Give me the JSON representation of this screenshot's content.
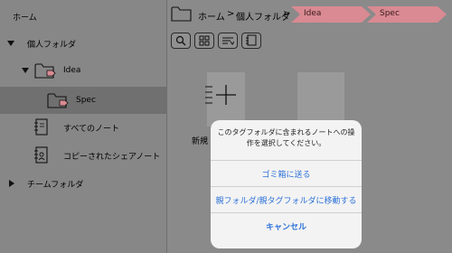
{
  "sidebar": {
    "home": "ホーム",
    "personal_folder": "個人フォルダ",
    "idea": "Idea",
    "spec": "Spec",
    "all_notes": "すべてのノート",
    "copied_shared_notes": "コピーされたシェアノート",
    "team_folder": "チームフォルダ"
  },
  "breadcrumb": {
    "home": "ホーム",
    "sep1": ">",
    "personal": "個人フォルダ",
    "sep2": ">",
    "tag1": "Idea",
    "tag2": "Spec"
  },
  "toolbar": {
    "icons": [
      "search-icon",
      "grid-icon",
      "sort-icon",
      "notebook-icon"
    ]
  },
  "main": {
    "new_note_label": "新規"
  },
  "dialog": {
    "message_line1": "このタグフォルダに含まれるノートへの操",
    "message_line2": "作を選択してください。",
    "trash_button": "ゴミ箱に送る",
    "move_button": "親フォルダ/親タグフォルダに移動する",
    "cancel_button": "キャンセル"
  },
  "colors": {
    "accent": "#2f73d8",
    "tag_chip": "#d98a92",
    "selected_row": "#707070"
  }
}
